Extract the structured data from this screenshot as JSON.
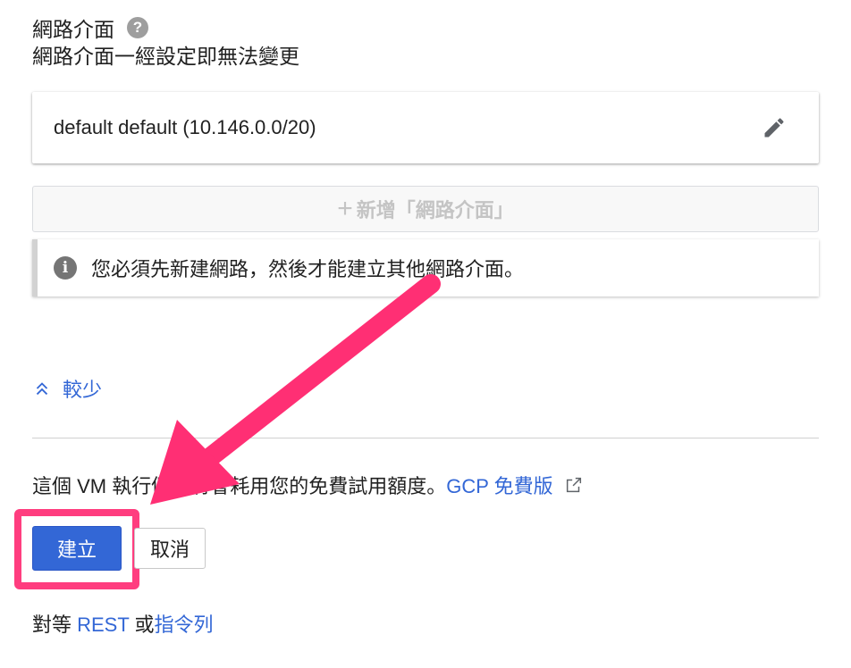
{
  "network": {
    "title": "網路介面",
    "help_icon": "help-circle-icon",
    "subtitle": "網路介面一經設定即無法變更",
    "interface_text": "default default (10.146.0.0/20)",
    "edit_icon": "pencil-icon",
    "add_button_label": "新增「網路介面」",
    "add_icon": "plus-icon",
    "info_icon": "info-icon",
    "info_text": "您必須先新建網路，然後才能建立其他網路介面。"
  },
  "less_link": {
    "label": "較少",
    "icon": "chevron-up-double-icon"
  },
  "free_tier": {
    "text": "這個 VM 執行個體將會耗用您的免費試用額度。",
    "link_label": "GCP 免費版",
    "ext_icon": "external-link-icon"
  },
  "actions": {
    "create_label": "建立",
    "cancel_label": "取消"
  },
  "equivalent": {
    "prefix": "對等 ",
    "rest_label": "REST",
    "or_text": " 或",
    "cli_label": "指令列"
  },
  "annotation": {
    "highlight_color": "#ff3d7f"
  },
  "colors": {
    "accent": "#3367d6",
    "text": "#212121",
    "disabled": "#c4c4c4"
  }
}
